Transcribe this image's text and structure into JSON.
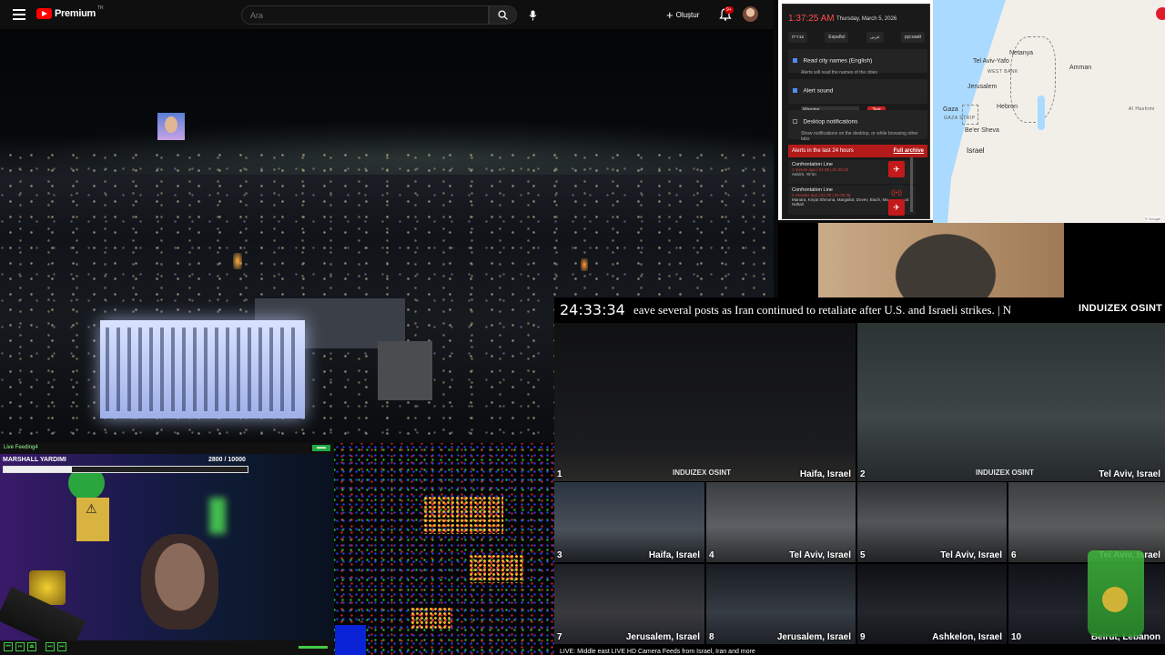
{
  "youtube": {
    "brand": "Premium",
    "region": "TR",
    "search_placeholder": "Ara",
    "create_label": "Oluştur",
    "notification_badge": "9+"
  },
  "alert_panel": {
    "time": "1:37:25 AM",
    "date": "Thursday, March 5, 2026",
    "languages": [
      "עברית",
      "Español",
      "عربى",
      "русский"
    ],
    "options": {
      "city_names": {
        "title": "Read city names (English)",
        "subtitle": "Alerts will read the names of the cities",
        "checked": true
      },
      "alert_sound": {
        "title": "Alert sound",
        "selected": "Warning",
        "test_label": "Test",
        "checked": true
      },
      "desktop": {
        "title": "Desktop notifications",
        "subtitle": "Show notifications on the desktop, or while browsing other tabs",
        "checked": false
      }
    },
    "list_title": "Alerts in the last 24 hours",
    "archive_label": "Full archive",
    "alerts": [
      {
        "title": "Confrontation Line",
        "status": "1 minute ago | 01:35 | 01:35:36",
        "cities": "Avivim, Yir'on"
      },
      {
        "title": "Confrontation Line",
        "status": "2 minutes ago | 01:35 | 01:35:36",
        "cities": "Manara, Kiryat Shmona, Margaliot, Dovev, Biach, Malkia, Ramot Naftali"
      }
    ]
  },
  "map": {
    "labels": {
      "netanya": "Netanya",
      "tel_aviv": "Tel Aviv-Yafo",
      "west_bank": "WEST BANK",
      "jerusalem": "Jerusalem",
      "amman": "Amman",
      "hebron": "Hebron",
      "gaza": "Gaza",
      "gaza_strip": "GAZA STRIP",
      "beer_sheva": "Be'er Sheva",
      "israel": "Israel",
      "al_hashimi": "Al Hashimi",
      "google": "© Google"
    }
  },
  "osint": {
    "clock": "24:33:34",
    "ticker": "eave several posts as Iran continued to retaliate after U.S. and Israeli strikes.   |   N",
    "brand": "INDUIZEX OSINT",
    "watermark": "INDUIZEX OSINT",
    "footer": "LIVE: Middle east LIVE HD Camera Feeds from Israel, Iran and more",
    "cams": [
      {
        "num": "1",
        "label": "Haifa, Israel"
      },
      {
        "num": "2",
        "label": "Tel Aviv, Israel"
      },
      {
        "num": "3",
        "label": "Haifa, Israel"
      },
      {
        "num": "4",
        "label": "Tel Aviv, Israel"
      },
      {
        "num": "5",
        "label": "Tel Aviv, Israel"
      },
      {
        "num": "6",
        "label": "Tel Aviv, Israel"
      },
      {
        "num": "7",
        "label": "Jerusalem, Israel"
      },
      {
        "num": "8",
        "label": "Jerusalem, Israel"
      },
      {
        "num": "9",
        "label": "Ashkelon, Israel"
      },
      {
        "num": "10",
        "label": "Beirut, Lebanon"
      }
    ]
  },
  "streamer": {
    "live_label": "Live Feeding4",
    "name": "MARSHALL YARDIMI",
    "hp_text": "2800  / 10000",
    "hp_fraction": 0.28,
    "controls": [
      "⏮",
      "⏯",
      "⏏",
      "⏭",
      "⏭"
    ]
  },
  "colors": {
    "yt_red": "#ff0000",
    "alert_red": "#b31b1b",
    "alert_time": "#ff4d4d"
  }
}
